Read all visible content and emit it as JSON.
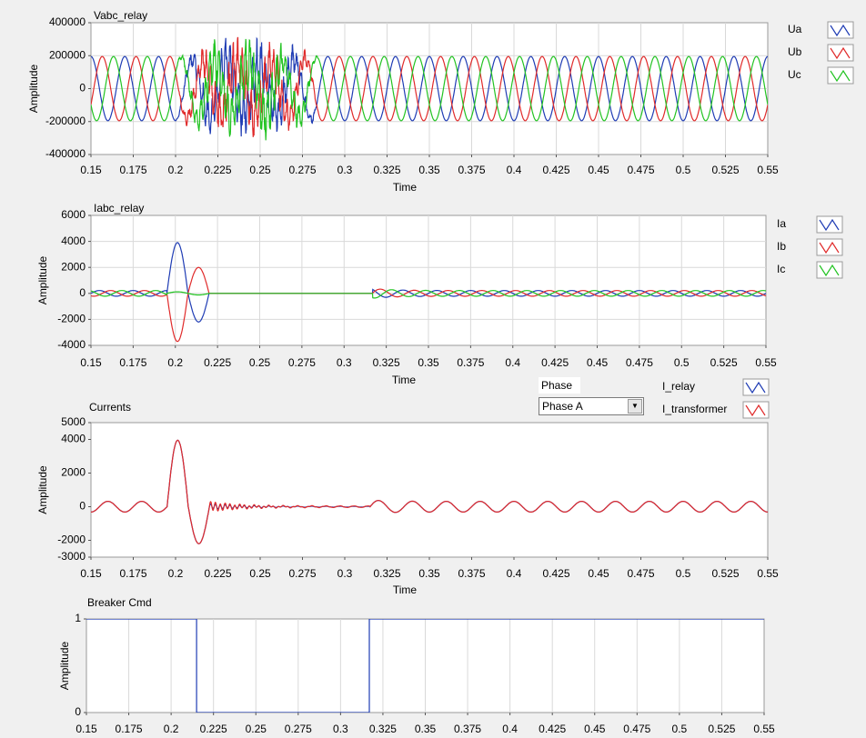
{
  "phase_control": {
    "label": "Phase",
    "selected": "Phase A"
  },
  "chart_data": [
    {
      "type": "line",
      "title": "Vabc_relay",
      "xlabel": "Time",
      "ylabel": "Amplitude",
      "xlim": [
        0.15,
        0.55
      ],
      "ylim": [
        -400000,
        400000
      ],
      "x_ticks": [
        "0.15",
        "0.175",
        "0.2",
        "0.225",
        "0.25",
        "0.275",
        "0.3",
        "0.325",
        "0.35",
        "0.375",
        "0.4",
        "0.425",
        "0.45",
        "0.475",
        "0.5",
        "0.525",
        "0.55"
      ],
      "y_ticks": [
        {
          "v": 400000,
          "t": "400000"
        },
        {
          "v": 200000,
          "t": "200000"
        },
        {
          "v": 0,
          "t": "0"
        },
        {
          "v": -200000,
          "t": "-200000"
        },
        {
          "v": -400000,
          "t": "-400000"
        }
      ],
      "grid": true,
      "legend": "right",
      "series": [
        {
          "name": "Ua",
          "color": "#1f3cb4"
        },
        {
          "name": "Ub",
          "color": "#e02a2a"
        },
        {
          "name": "Uc",
          "color": "#22c322"
        }
      ],
      "waveform": {
        "kind": "voltage",
        "amplitude": 195000,
        "frequency_hz": 50,
        "disturbance_start": 0.2,
        "disturbance_end": 0.285,
        "peak_during_disturbance": 270000
      }
    },
    {
      "type": "line",
      "title": "Iabc_relay",
      "xlabel": "Time",
      "ylabel": "Amplitude",
      "xlim": [
        0.15,
        0.55
      ],
      "ylim": [
        -4000,
        6000
      ],
      "x_ticks": [
        "0.15",
        "0.175",
        "0.2",
        "0.225",
        "0.25",
        "0.275",
        "0.3",
        "0.325",
        "0.35",
        "0.375",
        "0.4",
        "0.425",
        "0.45",
        "0.475",
        "0.5",
        "0.525",
        "0.55"
      ],
      "y_ticks": [
        {
          "v": 6000,
          "t": "6000"
        },
        {
          "v": 4000,
          "t": "4000"
        },
        {
          "v": 2000,
          "t": "2000"
        },
        {
          "v": 0,
          "t": "0"
        },
        {
          "v": -2000,
          "t": "-2000"
        },
        {
          "v": -4000,
          "t": "-4000"
        }
      ],
      "grid": true,
      "legend": "right",
      "series": [
        {
          "name": "Ia",
          "color": "#1f3cb4"
        },
        {
          "name": "Ib",
          "color": "#e02a2a"
        },
        {
          "name": "Ic",
          "color": "#22c322"
        }
      ],
      "waveform": {
        "kind": "current",
        "steady_amplitude": 220,
        "fault_start": 0.195,
        "fault_end": 0.22,
        "Ia_fault_peaks": [
          3900,
          -2200
        ],
        "Ib_fault_peaks": [
          -3700,
          2000
        ],
        "zero_interval": [
          0.22,
          0.317
        ],
        "reclose_transient_peak": 380
      }
    },
    {
      "type": "line",
      "title": "Currents",
      "xlabel": "Time",
      "ylabel": "Amplitude",
      "xlim": [
        0.15,
        0.55
      ],
      "ylim": [
        -3000,
        5000
      ],
      "x_ticks": [
        "0.15",
        "0.175",
        "0.2",
        "0.225",
        "0.25",
        "0.275",
        "0.3",
        "0.325",
        "0.35",
        "0.375",
        "0.4",
        "0.425",
        "0.45",
        "0.475",
        "0.5",
        "0.525",
        "0.55"
      ],
      "y_ticks": [
        {
          "v": 5000,
          "t": "5000"
        },
        {
          "v": 4000,
          "t": "4000"
        },
        {
          "v": 2000,
          "t": "2000"
        },
        {
          "v": 0,
          "t": "0"
        },
        {
          "v": -2000,
          "t": "-2000"
        },
        {
          "v": -3000,
          "t": "-3000"
        }
      ],
      "grid": false,
      "legend": "top-right",
      "series": [
        {
          "name": "I_relay",
          "color": "#1f3cb4"
        },
        {
          "name": "I_transformer",
          "color": "#e02a2a"
        }
      ],
      "waveform": {
        "kind": "phase_current",
        "steady_amplitude": 320,
        "fault_peak": 3950,
        "fault_trough": -2200,
        "inrush_ring_amplitude": 250,
        "ring_interval": [
          0.22,
          0.315
        ]
      }
    },
    {
      "type": "line",
      "title": "Breaker Cmd",
      "xlabel": "",
      "ylabel": "Amplitude",
      "xlim": [
        0.15,
        0.55
      ],
      "ylim": [
        0,
        1
      ],
      "x_ticks": [
        "0.15",
        "0.175",
        "0.2",
        "0.225",
        "0.25",
        "0.275",
        "0.3",
        "0.325",
        "0.35",
        "0.375",
        "0.4",
        "0.425",
        "0.45",
        "0.475",
        "0.5",
        "0.525",
        "0.55"
      ],
      "y_ticks": [
        {
          "v": 1,
          "t": "1"
        },
        {
          "v": 0,
          "t": "0"
        }
      ],
      "grid": true,
      "legend": "none",
      "series": [
        {
          "color": "#1f3cb4",
          "points": [
            [
              0.15,
              1
            ],
            [
              0.215,
              1
            ],
            [
              0.215,
              0
            ],
            [
              0.317,
              0
            ],
            [
              0.317,
              1
            ],
            [
              0.55,
              1
            ]
          ]
        }
      ]
    }
  ]
}
